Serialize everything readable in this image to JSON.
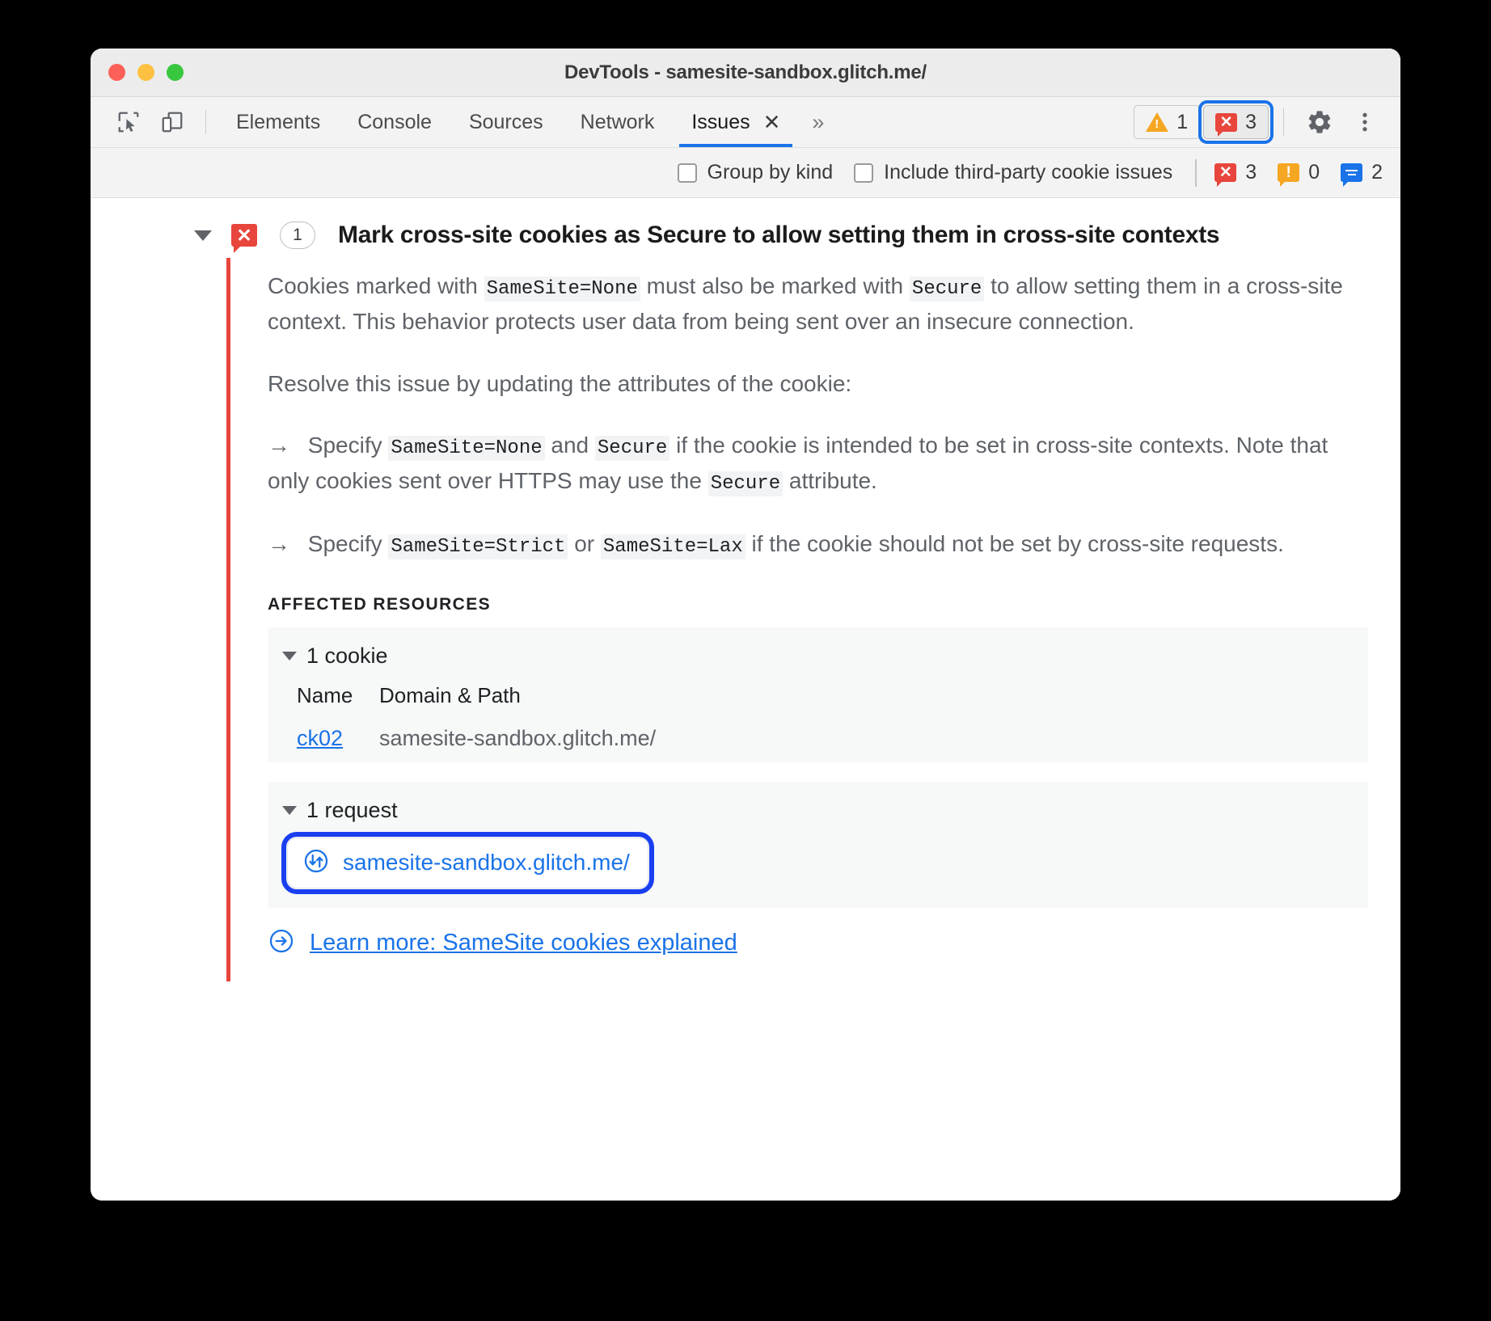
{
  "window": {
    "title": "DevTools - samesite-sandbox.glitch.me/",
    "traffic_lights": [
      "close",
      "minimize",
      "zoom"
    ]
  },
  "toolbar": {
    "icons": [
      {
        "name": "inspect-element-icon",
        "label": "Inspect element"
      },
      {
        "name": "device-toolbar-icon",
        "label": "Toggle device toolbar"
      }
    ],
    "tabs": [
      {
        "label": "Elements",
        "active": false
      },
      {
        "label": "Console",
        "active": false
      },
      {
        "label": "Sources",
        "active": false
      },
      {
        "label": "Network",
        "active": false
      },
      {
        "label": "Issues",
        "active": true,
        "closeable": true
      }
    ],
    "more_tabs_label": "»",
    "close_tab_label": "✕",
    "warning_count": "1",
    "error_count": "3",
    "settings_label": "Settings",
    "more_options_label": "Customize and control DevTools"
  },
  "filterbar": {
    "checkboxes": [
      {
        "label": "Group by kind",
        "checked": false
      },
      {
        "label": "Include third-party cookie issues",
        "checked": false
      }
    ],
    "stats": [
      {
        "kind": "error",
        "count": "3",
        "color": "#e8453c"
      },
      {
        "kind": "warning",
        "count": "0",
        "color": "#f5a623"
      },
      {
        "kind": "info",
        "count": "2",
        "color": "#1a73e8"
      }
    ]
  },
  "issue": {
    "severity": "error",
    "occurrence_count": "1",
    "title": "Mark cross-site cookies as Secure to allow setting them in cross-site contexts",
    "paragraph1": {
      "part1": "Cookies marked with ",
      "code1": "SameSite=None",
      "part2": " must also be marked with ",
      "code2": "Secure",
      "part3": " to allow setting them in a cross-site context. This behavior protects user data from being sent over an insecure connection."
    },
    "paragraph2": "Resolve this issue by updating the attributes of the cookie:",
    "bullet1": {
      "arrow": "→",
      "part1": " Specify ",
      "code1": "SameSite=None",
      "part2": " and ",
      "code2": "Secure",
      "part3": " if the cookie is intended to be set in cross-site contexts. Note that only cookies sent over HTTPS may use the ",
      "code3": "Secure",
      "part4": " attribute."
    },
    "bullet2": {
      "arrow": "→",
      "part1": " Specify ",
      "code1": "SameSite=Strict",
      "part2": " or ",
      "code2": "SameSite=Lax",
      "part3": " if the cookie should not be set by cross-site requests."
    },
    "affected_resources_label": "AFFECTED RESOURCES",
    "cookies_group": {
      "label": "1 cookie",
      "expanded": true,
      "columns": [
        "Name",
        "Domain & Path"
      ],
      "rows": [
        {
          "name": "ck02",
          "domain_path": "samesite-sandbox.glitch.me/"
        }
      ]
    },
    "requests_group": {
      "label": "1 request",
      "expanded": true,
      "rows": [
        {
          "url": "samesite-sandbox.glitch.me/",
          "icon": "request-arrows-icon",
          "highlighted": true
        }
      ]
    },
    "learn_more": {
      "icon": "arrow-right-circle-icon",
      "label": "Learn more: SameSite cookies explained"
    }
  },
  "colors": {
    "error_red": "#e8453c",
    "warning_orange": "#f5a623",
    "link_blue": "#1a73e8",
    "focus_blue": "#1a3ff0",
    "issue_border_red": "#e8453c"
  }
}
